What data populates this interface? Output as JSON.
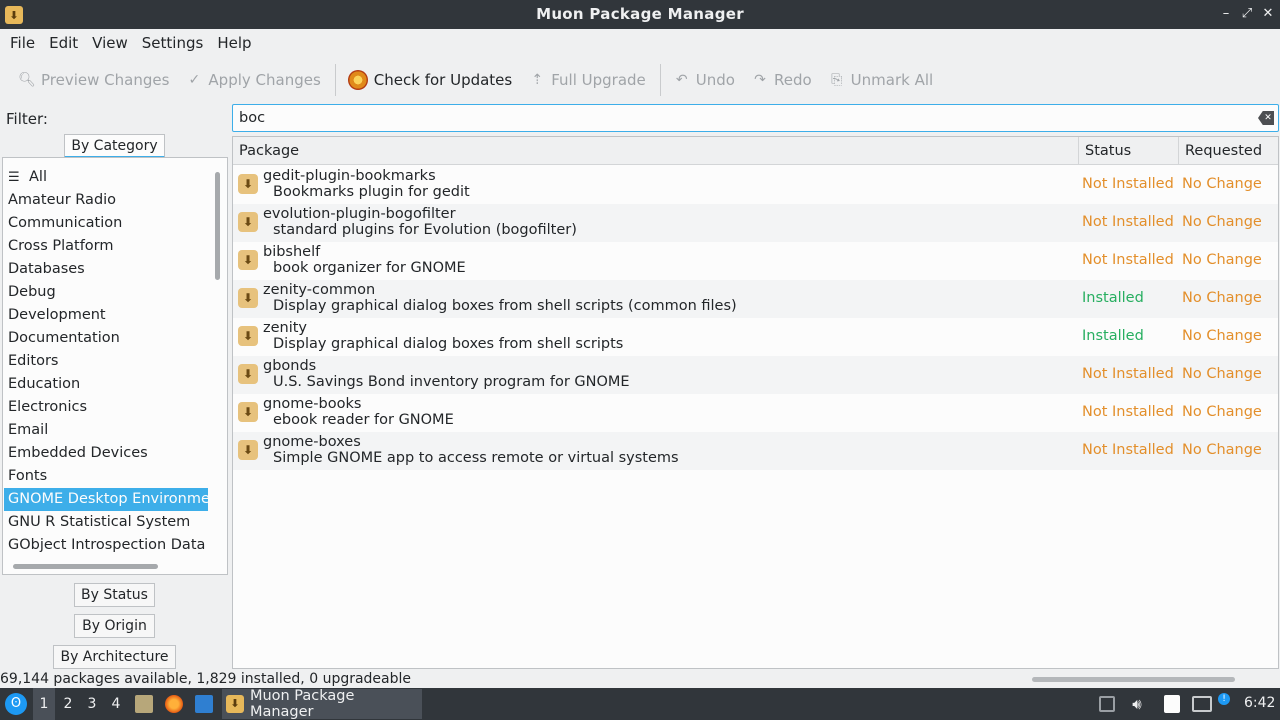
{
  "window": {
    "title": "Muon Package Manager"
  },
  "menu": [
    "File",
    "Edit",
    "View",
    "Settings",
    "Help"
  ],
  "toolbar": {
    "preview": "Preview Changes",
    "apply": "Apply Changes",
    "check_updates": "Check for Updates",
    "full_upgrade": "Full Upgrade",
    "undo": "Undo",
    "redo": "Redo",
    "unmark_all": "Unmark All"
  },
  "filter": {
    "label": "Filter:",
    "tabs": {
      "by_category": "By Category",
      "by_status": "By Status",
      "by_origin": "By Origin",
      "by_architecture": "By Architecture"
    },
    "categories": [
      "All",
      "Amateur Radio",
      "Communication",
      "Cross Platform",
      "Databases",
      "Debug",
      "Development",
      "Documentation",
      "Editors",
      "Education",
      "Electronics",
      "Email",
      "Embedded Devices",
      "Fonts",
      "GNOME Desktop Environment",
      "GNU R Statistical System",
      "GObject Introspection Data"
    ],
    "selected_category": "GNOME Desktop Environment"
  },
  "search": {
    "value": "boc"
  },
  "table": {
    "headers": {
      "package": "Package",
      "status": "Status",
      "requested": "Requested"
    },
    "rows": [
      {
        "name": "gedit-plugin-bookmarks",
        "desc": "Bookmarks plugin for gedit",
        "status": "Not Installed",
        "requested": "No Change"
      },
      {
        "name": "evolution-plugin-bogofilter",
        "desc": "standard plugins for Evolution (bogofilter)",
        "status": "Not Installed",
        "requested": "No Change"
      },
      {
        "name": "bibshelf",
        "desc": "book organizer for GNOME",
        "status": "Not Installed",
        "requested": "No Change"
      },
      {
        "name": "zenity-common",
        "desc": "Display graphical dialog boxes from shell scripts (common files)",
        "status": "Installed",
        "requested": "No Change"
      },
      {
        "name": "zenity",
        "desc": "Display graphical dialog boxes from shell scripts",
        "status": "Installed",
        "requested": "No Change"
      },
      {
        "name": "gbonds",
        "desc": "U.S. Savings Bond inventory program for GNOME",
        "status": "Not Installed",
        "requested": "No Change"
      },
      {
        "name": "gnome-books",
        "desc": "ebook reader for GNOME",
        "status": "Not Installed",
        "requested": "No Change"
      },
      {
        "name": "gnome-boxes",
        "desc": "Simple GNOME app to access remote or virtual systems",
        "status": "Not Installed",
        "requested": "No Change"
      }
    ]
  },
  "statusbar": {
    "text": "69,144 packages available, 1,829 installed, 0 upgradeable"
  },
  "taskbar": {
    "workspaces": [
      "1",
      "2",
      "3",
      "4"
    ],
    "task_title": "Muon Package Manager",
    "clock": "6:42"
  },
  "colors": {
    "accent": "#3daee9",
    "not_installed": "#e38f2b",
    "installed": "#27ae60",
    "titlebar": "#31363b"
  }
}
